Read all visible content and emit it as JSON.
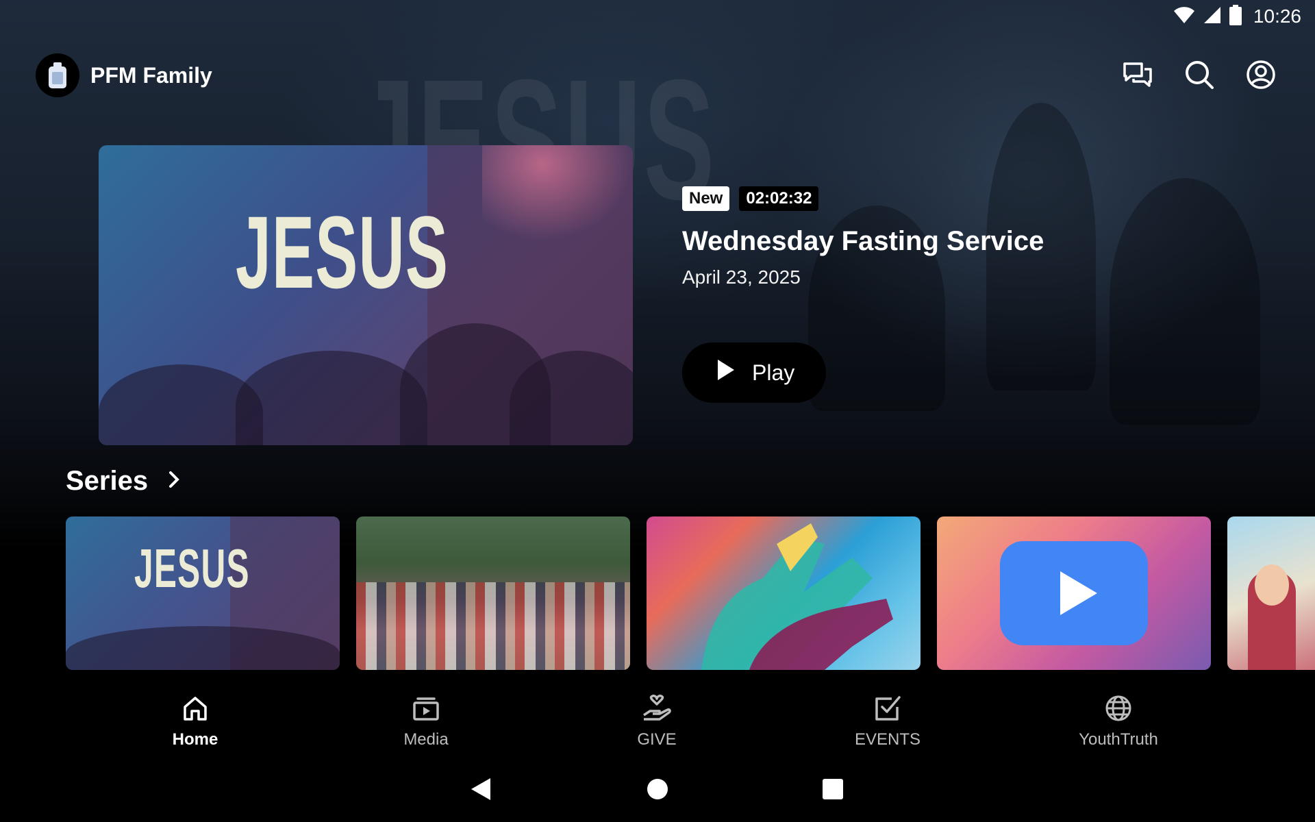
{
  "status_bar": {
    "time": "10:26"
  },
  "app": {
    "title": "PFM Family"
  },
  "featured": {
    "badge_new": "New",
    "duration": "02:02:32",
    "title": "Wednesday Fasting Service",
    "date": "April 23, 2025",
    "play_label": "Play",
    "thumbnail_text": "JESUS"
  },
  "background_text": "JESUS",
  "series": {
    "title": "Series",
    "cards": [
      {
        "thumbnail_text": "JESUS"
      },
      {},
      {},
      {},
      {}
    ]
  },
  "bottom_nav": {
    "items": [
      {
        "label": "Home",
        "icon": "home-icon",
        "active": true
      },
      {
        "label": "Media",
        "icon": "media-icon",
        "active": false
      },
      {
        "label": "GIVE",
        "icon": "give-icon",
        "active": false
      },
      {
        "label": "EVENTS",
        "icon": "events-icon",
        "active": false
      },
      {
        "label": "YouthTruth",
        "icon": "globe-icon",
        "active": false
      }
    ]
  },
  "colors": {
    "background_top": "#1e2a3b",
    "background_bottom": "#000000",
    "youtube_blue": "#4285f4",
    "inactive_nav": "#bdbdbd"
  }
}
